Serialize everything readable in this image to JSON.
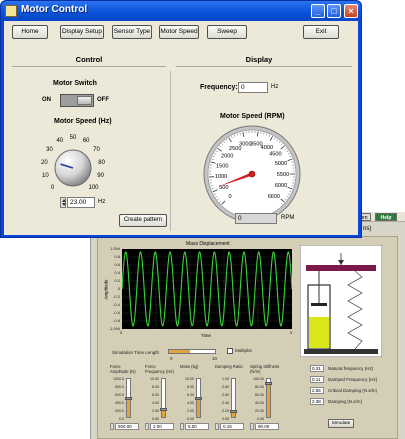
{
  "motor_window": {
    "title": "Motor Control",
    "min_symbol": "_",
    "max_symbol": "□",
    "close_symbol": "×",
    "nav": [
      "Home",
      "Display Setup",
      "Sensor Type",
      "Motor Speed",
      "Sweep",
      "Exit"
    ],
    "control": {
      "header": "Control",
      "switch_label": "Motor Switch",
      "switch_on": "ON",
      "switch_off": "OFF",
      "switch_state": "OFF",
      "speed_label": "Motor Speed (Hz)",
      "knob_scale": [
        "0",
        "10",
        "20",
        "30",
        "40",
        "50",
        "60",
        "70",
        "80",
        "90",
        "100"
      ],
      "knob_value": 23,
      "speed_value": "23.00",
      "speed_unit": "Hz",
      "pattern_button": "Create pattern"
    },
    "display": {
      "header": "Display",
      "frequency_label": "Frequency:",
      "frequency_value": "0",
      "frequency_unit": "Hz",
      "rpm_label": "Motor Speed (RPM)",
      "gauge_scale": [
        "0",
        "500",
        "1000",
        "1500",
        "2000",
        "2500",
        "3000",
        "3500",
        "4000",
        "4500",
        "5000",
        "5500",
        "6000",
        "6600"
      ],
      "gauge_value": 600,
      "rpm_value": "0",
      "rpm_unit": "RPM"
    }
  },
  "back_window": {
    "toolbar_return": "Return",
    "toolbar_help": "Help",
    "title_fragment": "ns)",
    "graph": {
      "title": "Mass Displacement",
      "ylabel": "Amplitude",
      "xlabel": "Time",
      "y_ticks": [
        "1.094",
        "0.8",
        "0.6",
        "0.4",
        "0.2",
        "0",
        "-0.2",
        "-0.4",
        "-0.6",
        "-0.8",
        "-1.094"
      ],
      "x_ticks": [
        "0",
        "5"
      ]
    },
    "sim_length_label": "Simulation Time Length",
    "sim_scale": [
      "0",
      "10"
    ],
    "sim_value_fraction": 0.45,
    "multiplot_label": "Multiplot",
    "params": [
      {
        "label": "Force Amplitude (N)",
        "scale": [
          "1000.0",
          "800.0",
          "600.0",
          "400.0",
          "200.0",
          "0.0"
        ],
        "value": "500.00",
        "fraction": 0.5
      },
      {
        "label": "Force Frequency (Hz)",
        "scale": [
          "10.00",
          "8.00",
          "6.00",
          "4.00",
          "2.00",
          "0.00"
        ],
        "value": "2.00",
        "fraction": 0.2
      },
      {
        "label": "Mass (kg)",
        "scale": [
          "10.00",
          "8.00",
          "6.00",
          "4.00",
          "2.00",
          "0.00"
        ],
        "value": "5.00",
        "fraction": 0.5
      },
      {
        "label": "Damping Ratio",
        "scale": [
          "1.00",
          "0.80",
          "0.60",
          "0.40",
          "0.20",
          "0.00"
        ],
        "value": "0.15",
        "fraction": 0.15
      },
      {
        "label": "Spring Stiffness (N/m)",
        "scale": [
          "100.00",
          "80.00",
          "60.00",
          "40.00",
          "20.00",
          "0.00"
        ],
        "value": "90.00",
        "fraction": 0.9
      }
    ],
    "outputs": [
      {
        "value": "0.31",
        "label": "Natural frequency (Hz)"
      },
      {
        "value": "0.11",
        "label": "Damped Frequency (Hz)"
      },
      {
        "value": "2.55",
        "label": "Critical Damping (N.s/m)"
      },
      {
        "value": "2.38",
        "label": "Damping (N.s/m)"
      }
    ],
    "simulate_button": "Simulate"
  },
  "colors": {
    "titlebar": "#0b53d8",
    "panel": "#ece9d8",
    "needle_gauge": "#d42020",
    "knob_marker": "#1f3ea8",
    "plot_bg": "#000000",
    "plot_trace": "#39d43a",
    "slider_fill": "#e0a53a",
    "mass_block": "#d8e61a",
    "beam": "#7a1a4a"
  }
}
